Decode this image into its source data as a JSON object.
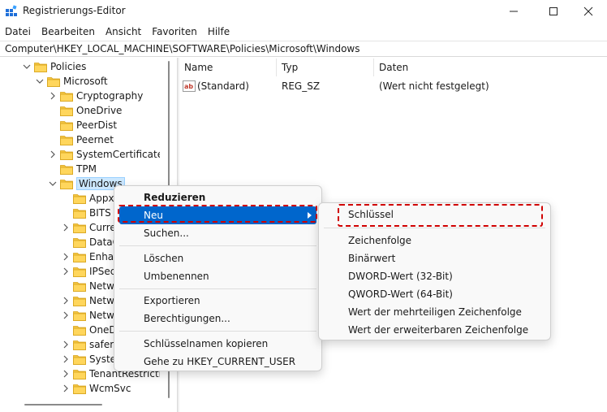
{
  "window": {
    "title": "Registrierungs-Editor",
    "minimize_icon": "minimize-icon",
    "maximize_icon": "maximize-icon",
    "close_icon": "close-icon"
  },
  "menubar": {
    "items": [
      "Datei",
      "Bearbeiten",
      "Ansicht",
      "Favoriten",
      "Hilfe"
    ]
  },
  "address": {
    "path": "Computer\\HKEY_LOCAL_MACHINE\\SOFTWARE\\Policies\\Microsoft\\Windows"
  },
  "tree": {
    "nodes": [
      {
        "label": "Policies",
        "state": "expanded"
      },
      {
        "label": "Microsoft",
        "state": "expanded"
      },
      {
        "label": "Cryptography",
        "state": "collapsed"
      },
      {
        "label": "OneDrive",
        "state": "leaf"
      },
      {
        "label": "PeerDist",
        "state": "leaf"
      },
      {
        "label": "Peernet",
        "state": "leaf"
      },
      {
        "label": "SystemCertificates",
        "state": "collapsed"
      },
      {
        "label": "TPM",
        "state": "leaf"
      },
      {
        "label": "Windows",
        "state": "expanded",
        "selected": true
      },
      {
        "label": "Appx",
        "state": "leaf"
      },
      {
        "label": "BITS",
        "state": "leaf"
      },
      {
        "label": "Curre",
        "state": "collapsed"
      },
      {
        "label": "DataC",
        "state": "leaf"
      },
      {
        "label": "Enhan",
        "state": "collapsed"
      },
      {
        "label": "IPSec",
        "state": "collapsed"
      },
      {
        "label": "Netw",
        "state": "leaf"
      },
      {
        "label": "Netw",
        "state": "collapsed"
      },
      {
        "label": "Netw",
        "state": "collapsed"
      },
      {
        "label": "OneD",
        "state": "leaf"
      },
      {
        "label": "safer",
        "state": "collapsed"
      },
      {
        "label": "Syste",
        "state": "collapsed"
      },
      {
        "label": "TenantRestrictio",
        "state": "collapsed"
      },
      {
        "label": "WcmSvc",
        "state": "collapsed"
      }
    ]
  },
  "list": {
    "columns": [
      "Name",
      "Typ",
      "Daten"
    ],
    "rows": [
      {
        "name": "(Standard)",
        "type": "REG_SZ",
        "data": "(Wert nicht festgelegt)",
        "icon": "string-value-icon"
      }
    ]
  },
  "context_menu": {
    "items": [
      {
        "label": "Reduzieren",
        "bold": true
      },
      {
        "label": "Neu",
        "highlighted": true,
        "submenu": true
      },
      {
        "label": "Suchen..."
      },
      {
        "separator": true
      },
      {
        "label": "Löschen"
      },
      {
        "label": "Umbenennen"
      },
      {
        "separator": true
      },
      {
        "label": "Exportieren"
      },
      {
        "label": "Berechtigungen..."
      },
      {
        "separator": true
      },
      {
        "label": "Schlüsselnamen kopieren"
      },
      {
        "label": "Gehe zu HKEY_CURRENT_USER"
      }
    ]
  },
  "submenu": {
    "items": [
      {
        "label": "Schlüssel",
        "marked": true
      },
      {
        "separator": true
      },
      {
        "label": "Zeichenfolge"
      },
      {
        "label": "Binärwert"
      },
      {
        "label": "DWORD-Wert (32-Bit)"
      },
      {
        "label": "QWORD-Wert (64-Bit)"
      },
      {
        "label": "Wert der mehrteiligen Zeichenfolge"
      },
      {
        "label": "Wert der erweiterbaren Zeichenfolge"
      }
    ]
  },
  "colors": {
    "highlight": "#0066cc",
    "marker": "#d00000",
    "folder": "#f4c542"
  }
}
